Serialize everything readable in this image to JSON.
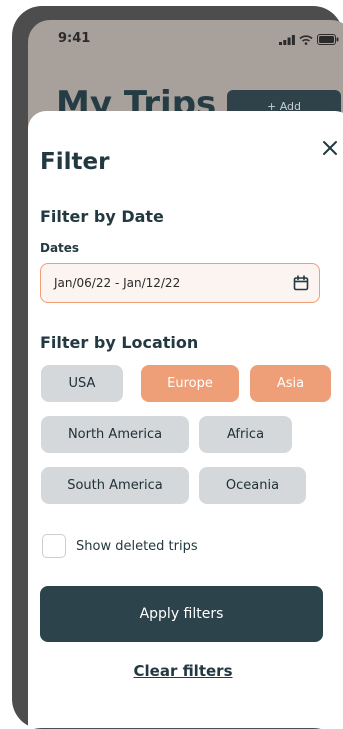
{
  "status_bar": {
    "time": "9:41",
    "icons": [
      "signal-icon",
      "wifi-icon",
      "battery-icon"
    ]
  },
  "background": {
    "title": "My Trips",
    "add_label": "+ Add"
  },
  "filter_sheet": {
    "title": "Filter",
    "close_icon": "close-icon",
    "date_section": {
      "title": "Filter by Date",
      "field_label": "Dates",
      "value": "Jan/06/22 - Jan/12/22",
      "icon": "calendar-icon"
    },
    "location_section": {
      "title": "Filter by Location",
      "chips": [
        {
          "label": "USA",
          "selected": false
        },
        {
          "label": "Europe",
          "selected": true
        },
        {
          "label": "Asia",
          "selected": true
        },
        {
          "label": "North America",
          "selected": false
        },
        {
          "label": "Africa",
          "selected": false
        },
        {
          "label": "South America",
          "selected": false
        },
        {
          "label": "Oceania",
          "selected": false
        }
      ]
    },
    "show_deleted": {
      "label": "Show deleted trips",
      "checked": false
    },
    "apply_label": "Apply filters",
    "clear_label": "Clear filters"
  },
  "colors": {
    "accent": "#ef9f77",
    "primary": "#2d434c",
    "chip_bg": "#d4d8da"
  }
}
